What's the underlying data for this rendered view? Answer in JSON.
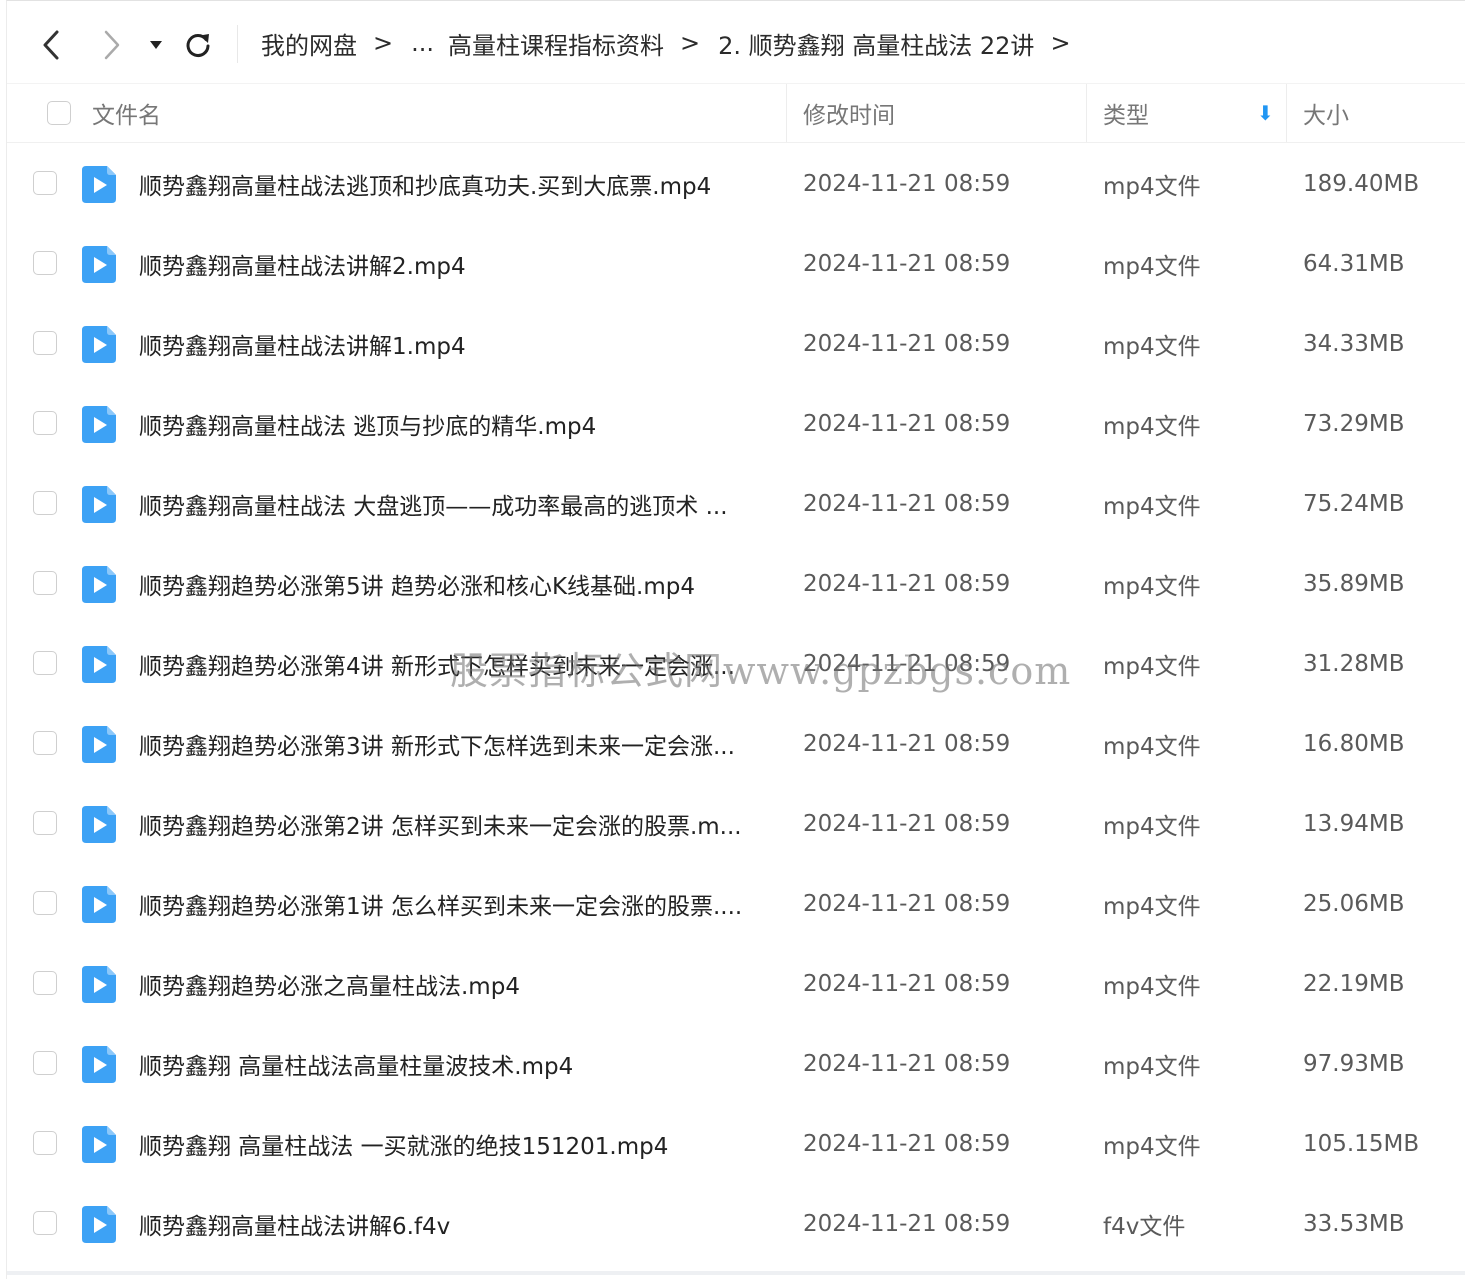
{
  "breadcrumb": {
    "root": "我的网盘",
    "ellipsis": "...",
    "parent": "高量柱课程指标资料",
    "current": "2. 顺势鑫翔 高量柱战法 22讲",
    "separator": ">"
  },
  "columns": {
    "name": "文件名",
    "modified": "修改时间",
    "type": "类型",
    "size": "大小",
    "sort_indicator": "⬇"
  },
  "icons": {
    "back": "chevron-left-icon",
    "forward": "chevron-right-icon",
    "history": "caret-down-icon",
    "refresh": "refresh-icon",
    "video_file": "video-file-icon"
  },
  "colors": {
    "video_icon": "#3da2f5",
    "sort_indicator": "#2196f3"
  },
  "files": [
    {
      "name": "顺势鑫翔高量柱战法逃顶和抄底真功夫.买到大底票.mp4",
      "modified": "2024-11-21 08:59",
      "type": "mp4文件",
      "size": "189.40MB"
    },
    {
      "name": "顺势鑫翔高量柱战法讲解2.mp4",
      "modified": "2024-11-21 08:59",
      "type": "mp4文件",
      "size": "64.31MB"
    },
    {
      "name": "顺势鑫翔高量柱战法讲解1.mp4",
      "modified": "2024-11-21 08:59",
      "type": "mp4文件",
      "size": "34.33MB"
    },
    {
      "name": "顺势鑫翔高量柱战法 逃顶与抄底的精华.mp4",
      "modified": "2024-11-21 08:59",
      "type": "mp4文件",
      "size": "73.29MB"
    },
    {
      "name": "顺势鑫翔高量柱战法 大盘逃顶——成功率最高的逃顶术 ...",
      "modified": "2024-11-21 08:59",
      "type": "mp4文件",
      "size": "75.24MB"
    },
    {
      "name": "顺势鑫翔趋势必涨第5讲 趋势必涨和核心K线基础.mp4",
      "modified": "2024-11-21 08:59",
      "type": "mp4文件",
      "size": "35.89MB"
    },
    {
      "name": "顺势鑫翔趋势必涨第4讲 新形式下怎样买到未来一定会涨...",
      "modified": "2024-11-21 08:59",
      "type": "mp4文件",
      "size": "31.28MB"
    },
    {
      "name": "顺势鑫翔趋势必涨第3讲 新形式下怎样选到未来一定会涨...",
      "modified": "2024-11-21 08:59",
      "type": "mp4文件",
      "size": "16.80MB"
    },
    {
      "name": "顺势鑫翔趋势必涨第2讲 怎样买到未来一定会涨的股票.m...",
      "modified": "2024-11-21 08:59",
      "type": "mp4文件",
      "size": "13.94MB"
    },
    {
      "name": "顺势鑫翔趋势必涨第1讲 怎么样买到未来一定会涨的股票....",
      "modified": "2024-11-21 08:59",
      "type": "mp4文件",
      "size": "25.06MB"
    },
    {
      "name": "顺势鑫翔趋势必涨之高量柱战法.mp4",
      "modified": "2024-11-21 08:59",
      "type": "mp4文件",
      "size": "22.19MB"
    },
    {
      "name": "顺势鑫翔 高量柱战法高量柱量波技术.mp4",
      "modified": "2024-11-21 08:59",
      "type": "mp4文件",
      "size": "97.93MB"
    },
    {
      "name": "顺势鑫翔 高量柱战法 一买就涨的绝技151201.mp4",
      "modified": "2024-11-21 08:59",
      "type": "mp4文件",
      "size": "105.15MB"
    },
    {
      "name": "顺势鑫翔高量柱战法讲解6.f4v",
      "modified": "2024-11-21 08:59",
      "type": "f4v文件",
      "size": "33.53MB"
    }
  ],
  "watermark": "股票指标公式网www.gpzbgs.com"
}
